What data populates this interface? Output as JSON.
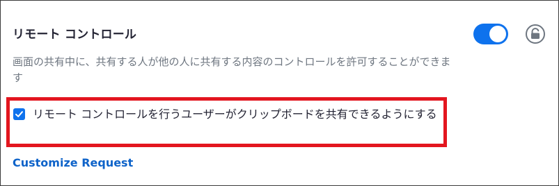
{
  "setting": {
    "title": "リモート コントロール",
    "enabled": true,
    "description": "画面の共有中に、共有する人が他の人に共有する内容のコントロールを許可することができます"
  },
  "option": {
    "checked": true,
    "label": "リモート コントロールを行うユーザーがクリップボードを共有できるようにする"
  },
  "customize_link": "Customize Request",
  "colors": {
    "accent": "#0e72ed",
    "highlight": "#e3161f",
    "link": "#0e63c9"
  },
  "icons": {
    "toggle": "toggle-switch",
    "lock": "unlocked-padlock-icon",
    "checkbox": "checkmark-icon"
  }
}
